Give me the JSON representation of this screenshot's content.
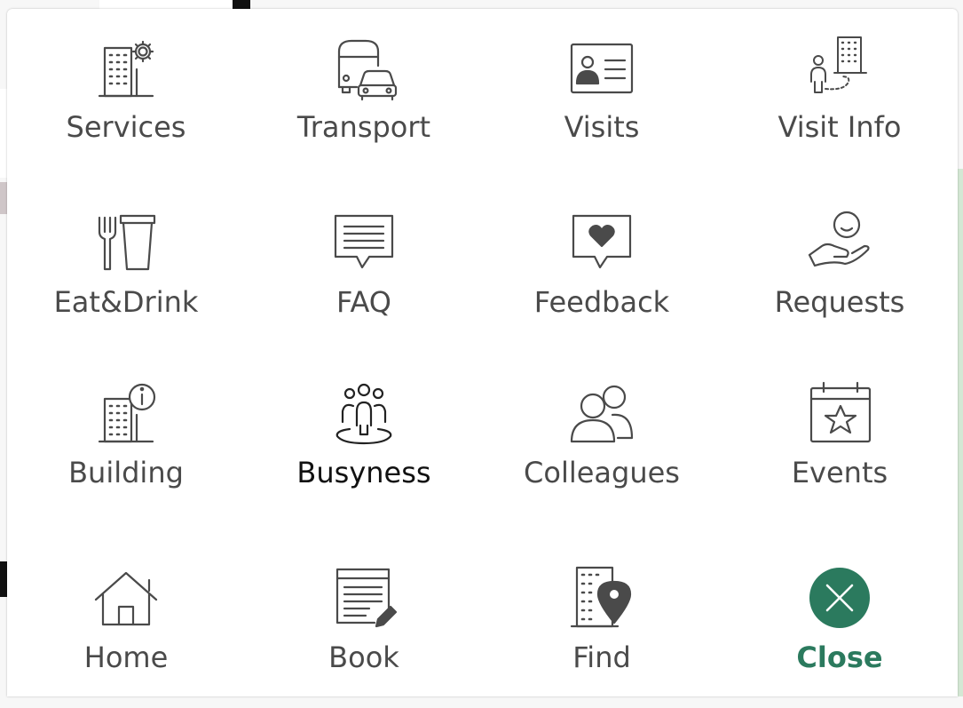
{
  "menu": {
    "items": [
      {
        "label": "Services",
        "icon": "building-gear-icon"
      },
      {
        "label": "Transport",
        "icon": "bus-car-icon"
      },
      {
        "label": "Visits",
        "icon": "id-card-icon"
      },
      {
        "label": "Visit Info",
        "icon": "visitor-route-icon"
      },
      {
        "label": "Eat&Drink",
        "icon": "fork-cup-icon"
      },
      {
        "label": "FAQ",
        "icon": "chat-bubble-icon"
      },
      {
        "label": "Feedback",
        "icon": "heart-bubble-icon"
      },
      {
        "label": "Requests",
        "icon": "hand-person-icon"
      },
      {
        "label": "Building",
        "icon": "building-info-icon"
      },
      {
        "label": "Busyness",
        "icon": "crowd-icon"
      },
      {
        "label": "Colleagues",
        "icon": "people-icon"
      },
      {
        "label": "Events",
        "icon": "calendar-star-icon"
      },
      {
        "label": "Home",
        "icon": "house-icon"
      },
      {
        "label": "Book",
        "icon": "document-pencil-icon"
      },
      {
        "label": "Find",
        "icon": "building-pin-icon"
      },
      {
        "label": "Close",
        "icon": "close-icon"
      }
    ]
  },
  "colors": {
    "icon_stroke": "#4a4a4a",
    "label_text": "#4a4a4a",
    "active_text": "#111111",
    "accent": "#2b7a5e"
  }
}
